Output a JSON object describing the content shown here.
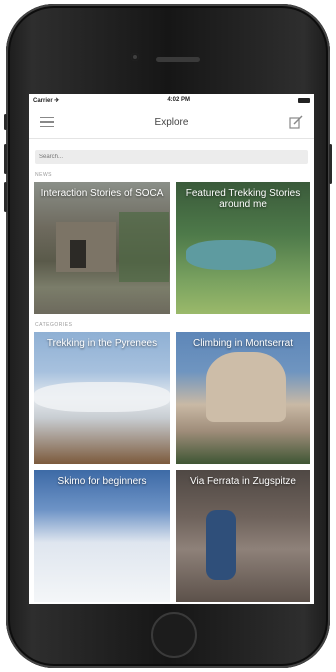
{
  "status": {
    "carrier": "Carrier ✈",
    "time": "4:02 PM"
  },
  "nav": {
    "title": "Explore"
  },
  "search": {
    "placeholder": "Search..."
  },
  "sections": {
    "news_label": "NEWS",
    "categories_label": "CATEGORIES"
  },
  "news": [
    {
      "title": "Interaction Stories of SOCA"
    },
    {
      "title": "Featured Trekking Stories around me"
    }
  ],
  "categories": [
    {
      "title": "Trekking in the Pyrenees"
    },
    {
      "title": "Climbing in Montserrat"
    },
    {
      "title": "Skimo for beginners"
    },
    {
      "title": "Via Ferrata in Zugspitze"
    }
  ],
  "colors": {
    "phone_body": "#1b1b1b",
    "screen_bg": "#ffffff",
    "nav_text": "#444444",
    "section_label": "#9a9a9a"
  },
  "icons": {
    "menu": "menu-icon",
    "compose": "compose-icon"
  }
}
